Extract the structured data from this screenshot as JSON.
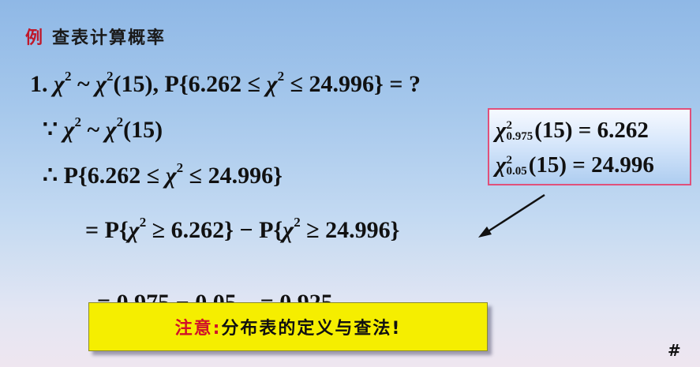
{
  "heading": {
    "label": "例",
    "title": "查表计算概率"
  },
  "lines": {
    "l1": {
      "a": "1. ",
      "chi": "χ",
      "sup1": "2",
      "b": " ~ ",
      "chi2": "χ",
      "sup2": "2",
      "c": "(15),  P{6.262 ≤ ",
      "chi3": "χ",
      "sup3": "2",
      "d": " ≤ 24.996} = ?"
    },
    "l2": {
      "a": "∵ ",
      "chi": "χ",
      "sup1": "2",
      "b": " ~ ",
      "chi2": "χ",
      "sup2": "2",
      "c": "(15)"
    },
    "l3": {
      "a": "∴ P{6.262 ≤ ",
      "chi": "χ",
      "sup1": "2",
      "b": " ≤ 24.996}"
    },
    "l4": {
      "a": "= P{",
      "chi": "χ",
      "sup1": "2",
      "b": " ≥ 6.262} − P{",
      "chi2": "χ",
      "sup2": "2",
      "c": " ≥ 24.996}"
    },
    "l5": {
      "a": "= 0.975 − 0.05    = 0.925"
    }
  },
  "box": {
    "row1": {
      "chi": "χ",
      "sup": "2",
      "sub": "0.975",
      "rest": "(15) = 6.262"
    },
    "row2": {
      "chi": "χ",
      "sup": "2",
      "sub": "0.05",
      "rest": "(15) = 24.996"
    }
  },
  "note": {
    "label": "注意:",
    "text": " 分布表的定义与查法!"
  },
  "page_marker": "#",
  "colors": {
    "accent_red": "#c0182a",
    "box_border": "#e0507a",
    "note_bg": "#f5ee00"
  }
}
